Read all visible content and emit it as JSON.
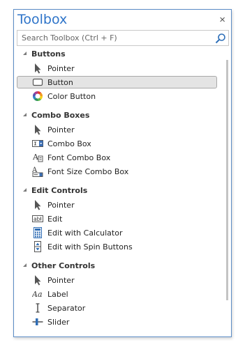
{
  "window": {
    "title": "Toolbox",
    "close_glyph": "×"
  },
  "search": {
    "placeholder": "Search Toolbox (Ctrl + F)",
    "icon": "search-icon"
  },
  "groups": [
    {
      "label": "Buttons",
      "items": [
        {
          "label": "Pointer",
          "icon": "pointer-icon"
        },
        {
          "label": "Button",
          "icon": "button-icon",
          "selected": true
        },
        {
          "label": "Color Button",
          "icon": "color-wheel-icon"
        }
      ]
    },
    {
      "label": "Combo Boxes",
      "items": [
        {
          "label": "Pointer",
          "icon": "pointer-icon"
        },
        {
          "label": "Combo Box",
          "icon": "combo-box-icon"
        },
        {
          "label": "Font Combo Box",
          "icon": "font-combo-icon"
        },
        {
          "label": "Font Size Combo Box",
          "icon": "font-size-combo-icon"
        }
      ]
    },
    {
      "label": "Edit Controls",
      "items": [
        {
          "label": "Pointer",
          "icon": "pointer-icon"
        },
        {
          "label": "Edit",
          "icon": "edit-box-icon"
        },
        {
          "label": "Edit with Calculator",
          "icon": "calculator-icon"
        },
        {
          "label": "Edit with Spin Buttons",
          "icon": "spin-buttons-icon"
        }
      ]
    },
    {
      "label": "Other Controls",
      "items": [
        {
          "label": "Pointer",
          "icon": "pointer-icon"
        },
        {
          "label": "Label",
          "icon": "label-aa-icon"
        },
        {
          "label": "Separator",
          "icon": "separator-icon"
        },
        {
          "label": "Slider",
          "icon": "slider-icon"
        }
      ]
    }
  ],
  "colors": {
    "title": "#2e74c9",
    "border": "#5b8cc6",
    "selection_bg": "#e4e4e4"
  }
}
